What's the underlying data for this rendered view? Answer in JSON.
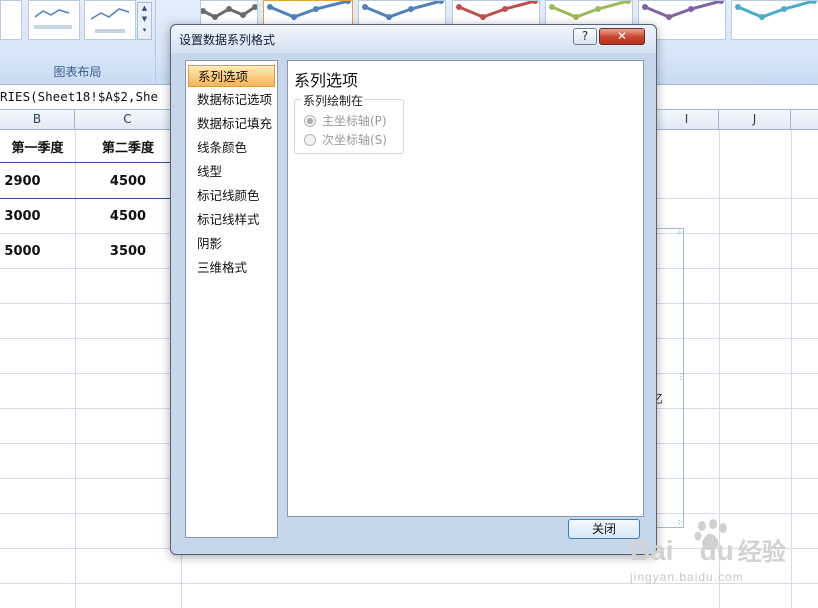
{
  "ribbon": {
    "group_label": "图表布局",
    "style_colors": [
      "#6b6b6b",
      "#4f81bd",
      "#4f81bd",
      "#c0504d",
      "#9bbb59",
      "#8064a2",
      "#4bacc6"
    ]
  },
  "formula_bar": {
    "text": "RIES(Sheet18!$A$2,She"
  },
  "sheet": {
    "columns": [
      "B",
      "C",
      "I",
      "J"
    ],
    "headers": [
      "第一季度",
      "第二季度"
    ],
    "rows": [
      [
        "2900",
        "4500"
      ],
      [
        "3000",
        "4500"
      ],
      [
        "5000",
        "3500"
      ]
    ]
  },
  "chart_fragment": {
    "axis_char": "亿"
  },
  "dialog": {
    "title": "设置数据系列格式",
    "help_label": "?",
    "close_x_label": "✕",
    "nav_items": [
      "系列选项",
      "数据标记选项",
      "数据标记填充",
      "线条颜色",
      "线型",
      "标记线颜色",
      "标记线样式",
      "阴影",
      "三维格式"
    ],
    "selected_nav": "系列选项",
    "content_heading": "系列选项",
    "group_title": "系列绘制在",
    "options": [
      {
        "label": "主坐标轴(P)",
        "checked": true
      },
      {
        "label": "次坐标轴(S)",
        "checked": false
      }
    ],
    "close_button": "关闭"
  },
  "watermark": {
    "brand_a": "Bai",
    "brand_b": "du",
    "brand_suffix": "经验",
    "url": "jingyan.baidu.com"
  }
}
